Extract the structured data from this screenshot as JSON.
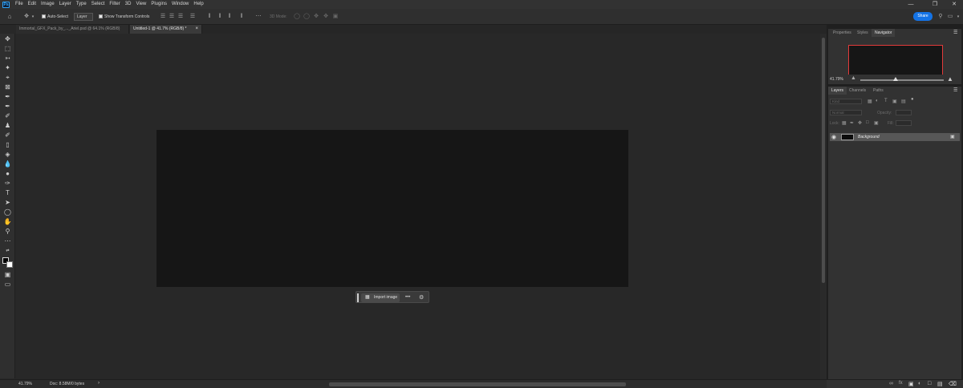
{
  "app": {
    "logo": "Ps"
  },
  "menu": [
    "File",
    "Edit",
    "Image",
    "Layer",
    "Type",
    "Select",
    "Filter",
    "3D",
    "View",
    "Plugins",
    "Window",
    "Help"
  ],
  "options": {
    "auto_select_label": "Auto-Select",
    "layer_select_value": "Layer",
    "show_transform_label": "Show Transform Controls",
    "threed_mode_label": "3D Mode:",
    "share_label": "Share"
  },
  "tabs": [
    {
      "title": "Immortal_GFX_Pack_by_..._Ariel.psd @ 64.1% (RGB/8)"
    },
    {
      "title": "Untitled-1 @ 41.7% (RGB/8) *"
    }
  ],
  "context_bar": {
    "import_label": "Import image",
    "more_label": "•••"
  },
  "status": {
    "zoom": "41.79%",
    "doc": "Doc: 8.58M/0 bytes"
  },
  "navigator": {
    "tabs": [
      "Properties",
      "Styles",
      "Navigator"
    ],
    "zoom": "41.79%",
    "zoom_level_fraction": 0.42
  },
  "layers_panel": {
    "tabs": [
      "Layers",
      "Channels",
      "Paths"
    ],
    "kind_placeholder": "Kind",
    "blend_mode": "Normal",
    "opacity_label": "Opacity:",
    "lock_label": "Lock:",
    "fill_label": "Fill:",
    "layers": [
      {
        "name": "Background",
        "visible": true,
        "locked": true
      }
    ]
  },
  "colors": {
    "accent": "#1473e6",
    "nav_frame": "#e23a3a",
    "canvas": "#161616"
  }
}
